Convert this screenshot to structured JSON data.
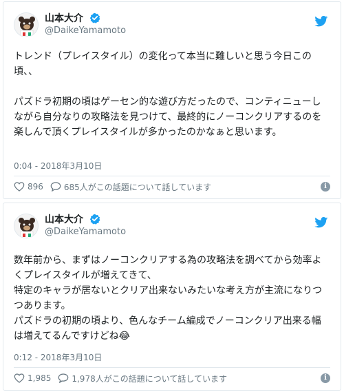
{
  "colors": {
    "twitter_blue": "#1da1f2",
    "text": "#1c2022",
    "muted": "#697882",
    "border": "#e1e8ed"
  },
  "tweets": [
    {
      "author_name": "山本大介",
      "handle": "@DaikeYamamoto",
      "body": "トレンド（プレイスタイル）の変化って本当に難しいと思う今日この頃、、\n\nパズドラ初期の頃はゲーセン的な遊び方だったので、コンティニューしながら自分なりの攻略法を見つけて、最終的にノーコンクリアするのを楽しんで頂くプレイスタイルが多かったのかなぁと思います。",
      "timestamp": "0:04 - 2018年3月10日",
      "likes": "896",
      "replies": "685人がこの話題について話しています",
      "info_glyph": "i"
    },
    {
      "author_name": "山本大介",
      "handle": "@DaikeYamamoto",
      "body": "数年前から、まずはノーコンクリアする為の攻略法を調べてから効率よくプレイスタイルが増えてきて、\n特定のキャラが居ないとクリア出来ないみたいな考え方が主流になりつつあります。\nパズドラの初期の頃より、色んなチーム編成でノーコンクリア出来る幅は増えてるんですけどね😂",
      "timestamp": "0:12 - 2018年3月10日",
      "likes": "1,985",
      "replies": "1,978人がこの話題について話しています",
      "info_glyph": "i"
    }
  ]
}
